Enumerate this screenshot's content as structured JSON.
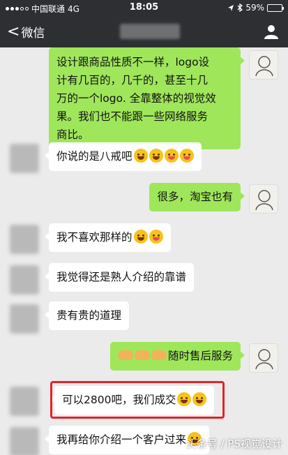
{
  "status_bar": {
    "carrier": "中国联通",
    "network": "4G",
    "time": "18:05",
    "battery": "59%",
    "battery_level": 0.59
  },
  "nav": {
    "back_label": "微信",
    "back_chevron": "<"
  },
  "messages": [
    {
      "side": "right",
      "lines": [
        "设计跟商品性质不一样，logo设",
        "计有几百的，几千的，甚至十几",
        "万的一个logo. 全靠整体的视觉效",
        "果。我们也不能跟一些网络服务",
        "商比。"
      ]
    },
    {
      "side": "left",
      "text": "你说的是八戒吧",
      "emojis": [
        "laugh-tears",
        "laugh-tears",
        "tongue",
        "tongue"
      ]
    },
    {
      "side": "right",
      "text": "很多，淘宝也有"
    },
    {
      "side": "left",
      "text": "我不喜欢那样的",
      "emojis": [
        "laugh-tears",
        "tongue"
      ]
    },
    {
      "side": "left",
      "text": "我觉得还是熟人介绍的靠谱"
    },
    {
      "side": "left",
      "text": "贵有贵的道理"
    },
    {
      "side": "right",
      "text": "随时售后服务",
      "prefix_emojis": [
        "handshake",
        "handshake",
        "handshake"
      ]
    },
    {
      "side": "left",
      "text": "可以2800吧，我们成交",
      "emojis": [
        "grin",
        "grin"
      ],
      "highlighted": true
    },
    {
      "side": "left",
      "text": "我再给你介绍一个客户过来",
      "emojis": [
        "grin"
      ]
    }
  ],
  "watermark": "头条号 / PS视觉设计",
  "colors": {
    "header": "#2e2f33",
    "background": "#ebebeb",
    "sent_bubble": "#9fe65b",
    "received_bubble": "#ffffff",
    "highlight": "#e0242a"
  }
}
